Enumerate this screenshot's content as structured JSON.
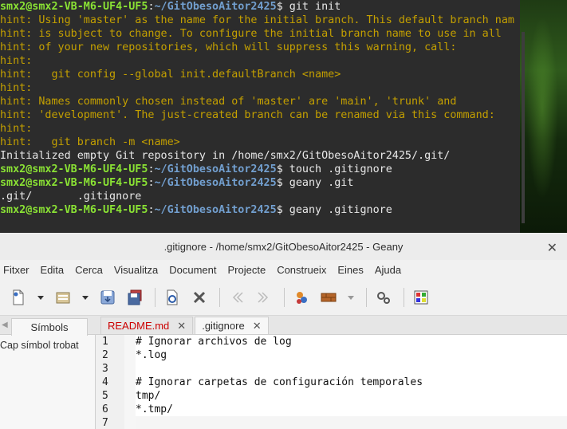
{
  "terminal": {
    "lines": [
      {
        "type": "prompt",
        "user": "smx2@smx2-VB-M6-UF4-UF5",
        "path": "~/GitObesoAitor2425",
        "cmd": "$ git init"
      },
      {
        "type": "hint",
        "text": "hint: Using 'master' as the name for the initial branch. This default branch nam"
      },
      {
        "type": "hint",
        "text": "hint: is subject to change. To configure the initial branch name to use in all"
      },
      {
        "type": "hint",
        "text": "hint: of your new repositories, which will suppress this warning, call:"
      },
      {
        "type": "hint",
        "text": "hint:"
      },
      {
        "type": "hint",
        "text": "hint:   git config --global init.defaultBranch <name>"
      },
      {
        "type": "hint",
        "text": "hint:"
      },
      {
        "type": "hint",
        "text": "hint: Names commonly chosen instead of 'master' are 'main', 'trunk' and"
      },
      {
        "type": "hint",
        "text": "hint: 'development'. The just-created branch can be renamed via this command:"
      },
      {
        "type": "hint",
        "text": "hint:"
      },
      {
        "type": "hint",
        "text": "hint:   git branch -m <name>"
      },
      {
        "type": "out",
        "text": "Initialized empty Git repository in /home/smx2/GitObesoAitor2425/.git/"
      },
      {
        "type": "prompt",
        "user": "smx2@smx2-VB-M6-UF4-UF5",
        "path": "~/GitObesoAitor2425",
        "cmd": "$ touch .gitignore"
      },
      {
        "type": "prompt",
        "user": "smx2@smx2-VB-M6-UF4-UF5",
        "path": "~/GitObesoAitor2425",
        "cmd": "$ geany .git"
      },
      {
        "type": "out",
        "text": ".git/       .gitignore"
      },
      {
        "type": "prompt",
        "user": "smx2@smx2-VB-M6-UF4-UF5",
        "path": "~/GitObesoAitor2425",
        "cmd": "$ geany .gitignore"
      }
    ]
  },
  "geany": {
    "title": ".gitignore - /home/smx2/GitObesoAitor2425 - Geany",
    "close_glyph": "✕",
    "menu": [
      "Fitxer",
      "Edita",
      "Cerca",
      "Visualitza",
      "Document",
      "Projecte",
      "Construeix",
      "Eines",
      "Ajuda"
    ],
    "sidebar_tab": "Símbols",
    "sidebar_text": "Cap símbol trobat",
    "tabs": [
      {
        "name": "README.md",
        "modified": true
      },
      {
        "name": ".gitignore",
        "modified": false
      }
    ],
    "tab_close_glyph": "✕",
    "line_numbers": [
      "1",
      "2",
      "3",
      "4",
      "5",
      "6",
      "7"
    ],
    "code": [
      "# Ignorar archivos de log",
      "*.log",
      "",
      "# Ignorar carpetas de configuración temporales",
      "tmp/",
      "*.tmp/",
      ""
    ],
    "colors": {
      "modified_tab": "#cc0000",
      "prompt_user": "#8ae234",
      "prompt_path": "#729fcf",
      "hint": "#c4a000"
    }
  }
}
